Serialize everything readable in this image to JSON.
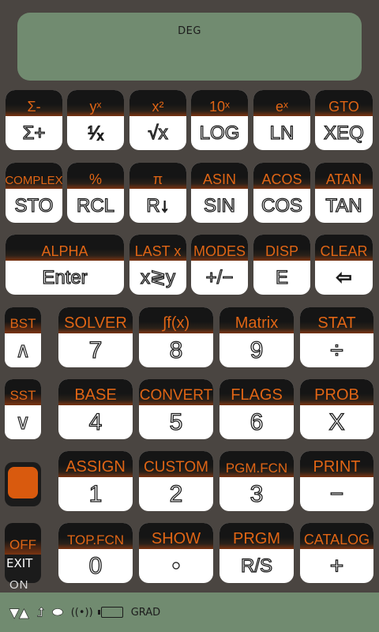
{
  "display": {
    "mode": "DEG"
  },
  "rows": [
    [
      {
        "shift": "Σ-",
        "main": "Σ+"
      },
      {
        "shift": "yˣ",
        "main": "¹⁄ₓ"
      },
      {
        "shift": "x²",
        "main": "√x"
      },
      {
        "shift": "10ˣ",
        "main": "LOG"
      },
      {
        "shift": "eˣ",
        "main": "LN"
      },
      {
        "shift": "GTO",
        "main": "XEQ"
      }
    ],
    [
      {
        "shift": "COMPLEX",
        "main": "STO"
      },
      {
        "shift": "%",
        "main": "RCL"
      },
      {
        "shift": "π",
        "main": "R↓"
      },
      {
        "shift": "ASIN",
        "main": "SIN"
      },
      {
        "shift": "ACOS",
        "main": "COS"
      },
      {
        "shift": "ATAN",
        "main": "TAN"
      }
    ],
    [
      {
        "shift": "ALPHA",
        "main": "Enter"
      },
      {
        "shift": "LAST x",
        "main": "x≷y"
      },
      {
        "shift": "MODES",
        "main": "+/−"
      },
      {
        "shift": "DISP",
        "main": "E"
      },
      {
        "shift": "CLEAR",
        "main": "⇦"
      }
    ],
    [
      {
        "shift": "SOLVER",
        "main": "7"
      },
      {
        "shift": "∫f(x)",
        "main": "8"
      },
      {
        "shift": "Matrix",
        "main": "9"
      },
      {
        "shift": "STAT",
        "main": "÷"
      }
    ],
    [
      {
        "shift": "BASE",
        "main": "4"
      },
      {
        "shift": "CONVERT",
        "main": "5"
      },
      {
        "shift": "FLAGS",
        "main": "6"
      },
      {
        "shift": "PROB",
        "main": "X"
      }
    ],
    [
      {
        "shift": "ASSIGN",
        "main": "1"
      },
      {
        "shift": "CUSTOM",
        "main": "2"
      },
      {
        "shift": "PGM.FCN",
        "main": "3"
      },
      {
        "shift": "PRINT",
        "main": "−"
      }
    ],
    [
      {
        "shift": "TOP.FCN",
        "main": "0"
      },
      {
        "shift": "SHOW",
        "main": "•"
      },
      {
        "shift": "PRGM",
        "main": "R/S"
      },
      {
        "shift": "CATALOG",
        "main": "+"
      }
    ]
  ],
  "side_keys": [
    {
      "shift": "BST",
      "main": "∧"
    },
    {
      "shift": "SST",
      "main": "∨"
    }
  ],
  "off_key": {
    "shift": "OFF",
    "main": "EXIT",
    "label": "ON"
  },
  "status": {
    "io_indicator": "((•))",
    "angle": "GRAD"
  }
}
